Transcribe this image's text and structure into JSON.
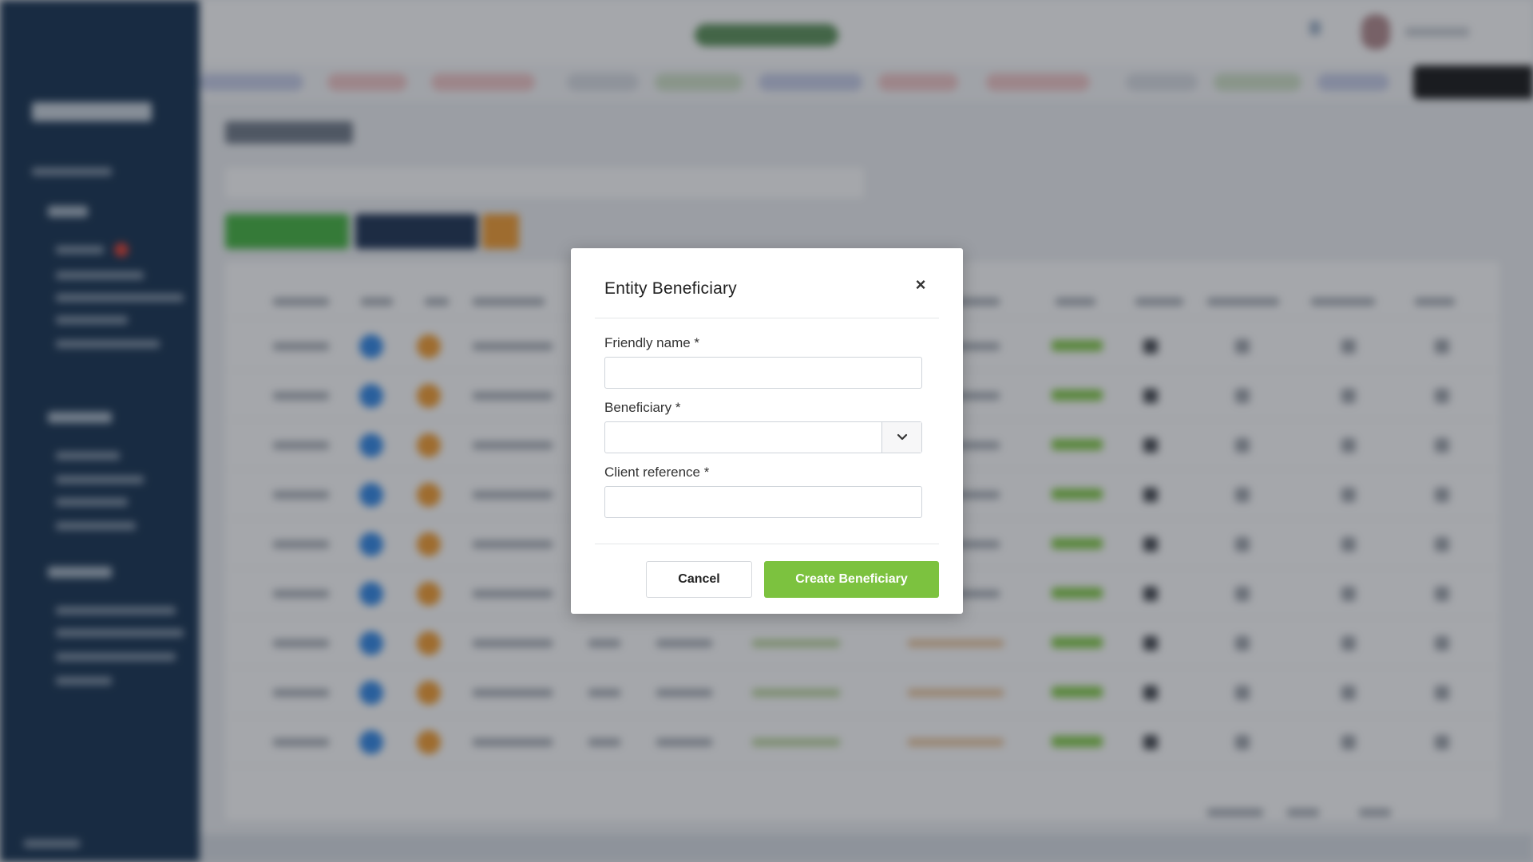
{
  "modal": {
    "title": "Entity Beneficiary",
    "close_symbol": "×",
    "fields": {
      "friendly_name": {
        "label": "Friendly name *",
        "value": ""
      },
      "beneficiary": {
        "label": "Beneficiary *",
        "value": ""
      },
      "client_reference": {
        "label": "Client reference *",
        "value": ""
      }
    },
    "cancel_label": "Cancel",
    "create_label": "Create Beneficiary"
  },
  "colors": {
    "primary_green": "#7cc23f",
    "sidebar_navy": "#0d2a4a",
    "overlay": "rgba(40,45,55,0.42)"
  },
  "icons": [
    "close-icon",
    "chevron-down-icon"
  ]
}
